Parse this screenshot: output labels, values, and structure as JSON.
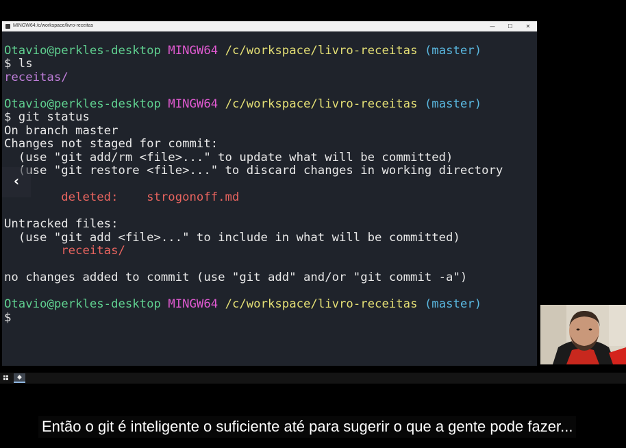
{
  "window": {
    "title": "MINGW64:/c/workspace/livro-receitas",
    "buttons": {
      "minimize": "—",
      "maximize": "☐",
      "close": "✕"
    }
  },
  "prompt": {
    "user_host": "Otavio@perkles-desktop",
    "env": "MINGW64",
    "path": "/c/workspace/livro-receitas",
    "branch": "(master)",
    "symbol": "$"
  },
  "terminal": {
    "cmd_ls": " ls",
    "ls_output": "receitas/",
    "cmd_status": " git status",
    "on_branch": "On branch master",
    "changes_header": "Changes not staged for commit:",
    "hint_add": "  (use \"git add/rm <file>...\" to update what will be committed)",
    "hint_restore": "  (use \"git restore <file>...\" to discard changes in working directory",
    "deleted_label": "        deleted:    ",
    "deleted_file": "strogonoff.md",
    "untracked_header": "Untracked files:",
    "hint_untracked": "  (use \"git add <file>...\" to include in what will be committed)",
    "untracked_file": "        receitas/",
    "summary": "no changes added to commit (use \"git add\" and/or \"git commit -a\")"
  },
  "video": {
    "back_arrow": "‹",
    "subtitle": "Então o git é inteligente o suficiente até para sugerir o que a gente pode fazer..."
  },
  "taskbar": {
    "app_glyph": "◆"
  },
  "colors": {
    "terminal_bg": "#1f232b",
    "user_host": "#5fcf8f",
    "env": "#e05ad1",
    "path": "#e4df75",
    "branch": "#5ab8e0",
    "directory": "#bf7ed9",
    "error": "#e8645f"
  }
}
